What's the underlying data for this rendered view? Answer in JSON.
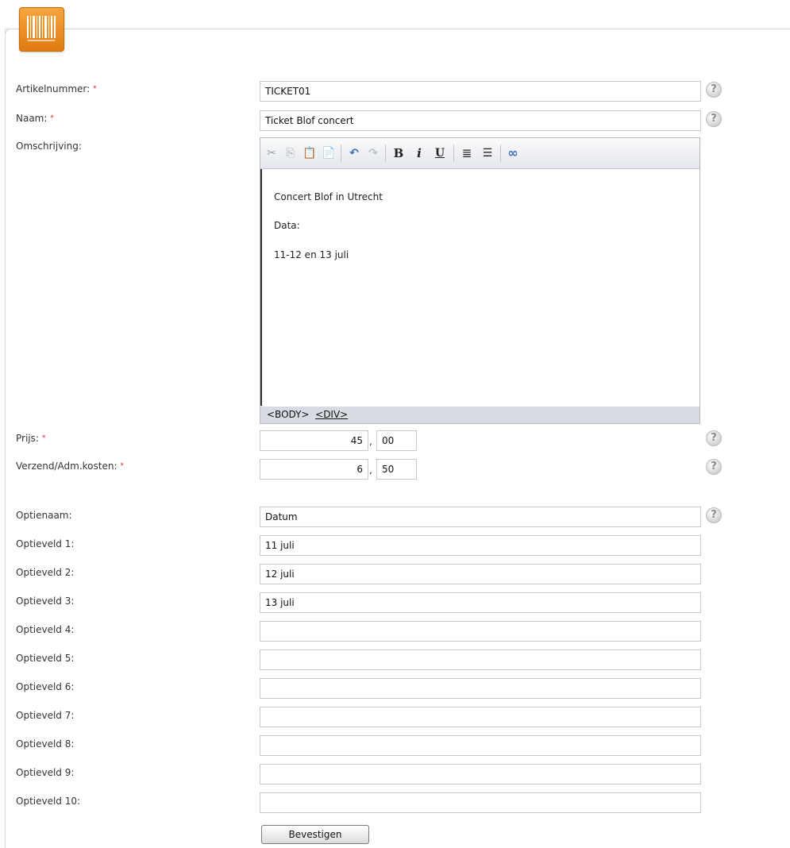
{
  "form": {
    "fields": {
      "artikelnummer": {
        "label": "Artikelnummer:",
        "value": "TICKET01",
        "required": true
      },
      "naam": {
        "label": "Naam:",
        "value": "Ticket Blof concert",
        "required": true
      },
      "omschrijving": {
        "label": "Omschrijving:"
      },
      "prijs": {
        "label": "Prijs:",
        "euros": "45",
        "cents": "00",
        "required": true
      },
      "verzendkosten": {
        "label": "Verzend/Adm.kosten:",
        "euros": "6",
        "cents": "50",
        "required": true
      },
      "optienaam": {
        "label": "Optienaam:",
        "value": "Datum"
      }
    },
    "required_marker": "*",
    "price_separator": ",",
    "help_symbol": "?",
    "optievelden": [
      {
        "label": "Optieveld 1:",
        "value": "11 juli"
      },
      {
        "label": "Optieveld 2:",
        "value": "12 juli"
      },
      {
        "label": "Optieveld 3:",
        "value": "13 juli"
      },
      {
        "label": "Optieveld 4:",
        "value": ""
      },
      {
        "label": "Optieveld 5:",
        "value": ""
      },
      {
        "label": "Optieveld 6:",
        "value": ""
      },
      {
        "label": "Optieveld 7:",
        "value": ""
      },
      {
        "label": "Optieveld 8:",
        "value": ""
      },
      {
        "label": "Optieveld 9:",
        "value": ""
      },
      {
        "label": "Optieveld 10:",
        "value": ""
      }
    ],
    "submit_label": "Bevestigen"
  },
  "editor": {
    "content": [
      "Concert Blof in Utrecht",
      "Data:",
      "11-12 en 13 juli"
    ],
    "status_body": "<BODY>",
    "status_div": "<DIV>",
    "toolbar": {
      "cut_icon": "✂",
      "copy_icon": "⎘",
      "paste_icon": "📋",
      "paste_word_icon": "📄",
      "undo_icon": "↶",
      "redo_icon": "↷",
      "bold": "B",
      "italic": "i",
      "underline": "U",
      "ordered_list_icon": "≣",
      "unordered_list_icon": "☰",
      "link_icon": "∞"
    }
  },
  "colors": {
    "accent": "#e98a1f",
    "required": "#dd2222",
    "help": "#9a9a9a"
  }
}
